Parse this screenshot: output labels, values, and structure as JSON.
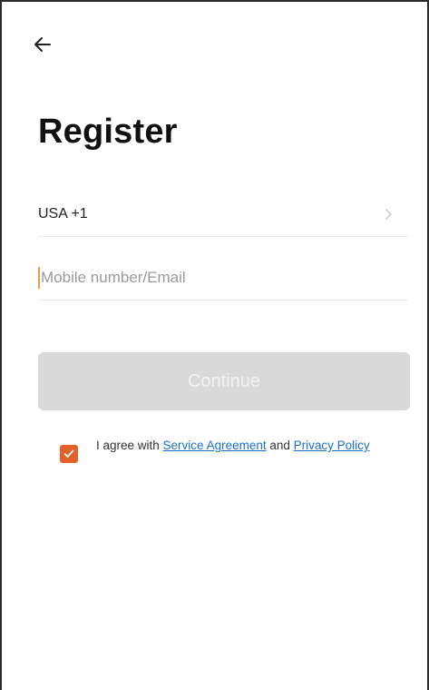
{
  "screen": {
    "title": "Register"
  },
  "country": {
    "label": "USA +1"
  },
  "phone_input": {
    "value": "",
    "placeholder": "Mobile number/Email"
  },
  "continue_button": {
    "label": "Continue"
  },
  "agreement": {
    "prefix": "I agree with ",
    "service_link": "Service Agreement",
    "middle": " and ",
    "privacy_link": "Privacy Policy",
    "checked": true
  },
  "colors": {
    "accent": "#e2602b",
    "link": "#1a6fd1",
    "button_disabled": "#d9d9d9"
  },
  "icons": {
    "back": "arrow-left-icon",
    "chevron": "chevron-right-icon",
    "check": "check-icon"
  }
}
